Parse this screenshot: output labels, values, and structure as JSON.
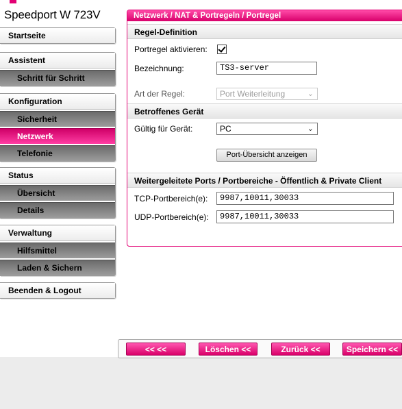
{
  "brand": {
    "title": "Speedport W 723V",
    "accent": "#e20074"
  },
  "sidebar": {
    "home": "Startseite",
    "assistant": {
      "label": "Assistent",
      "items": [
        "Schritt für Schritt"
      ]
    },
    "config": {
      "label": "Konfiguration",
      "items": [
        "Sicherheit",
        "Netzwerk",
        "Telefonie"
      ],
      "active": "Netzwerk"
    },
    "status": {
      "label": "Status",
      "items": [
        "Übersicht",
        "Details"
      ]
    },
    "admin": {
      "label": "Verwaltung",
      "items": [
        "Hilfsmittel",
        "Laden & Sichern"
      ]
    },
    "logout": "Beenden & Logout"
  },
  "panel": {
    "breadcrumb": "Netzwerk / NAT & Portregeln / Portregel",
    "rule_section": "Regel-Definition",
    "activate_label": "Portregel aktivieren:",
    "activate_checked": true,
    "name_label": "Bezeichnung:",
    "name_value": "TS3-server",
    "type_label": "Art der Regel:",
    "type_value": "Port Weiterleitung",
    "device_section": "Betroffenes Gerät",
    "device_label": "Gültig für Gerät:",
    "device_value": "PC",
    "port_overview_button": "Port-Übersicht anzeigen",
    "ports_section": "Weitergeleitete Ports / Portbereiche - Öffentlich & Private Client",
    "tcp_label": "TCP-Portbereich(e):",
    "tcp_value": "9987,10011,30033",
    "udp_label": "UDP-Portbereich(e):",
    "udp_value": "9987,10011,30033"
  },
  "actions": {
    "back_all": "<<  <<",
    "delete": "Löschen <<",
    "back": "Zurück <<",
    "save": "Speichern <<"
  }
}
